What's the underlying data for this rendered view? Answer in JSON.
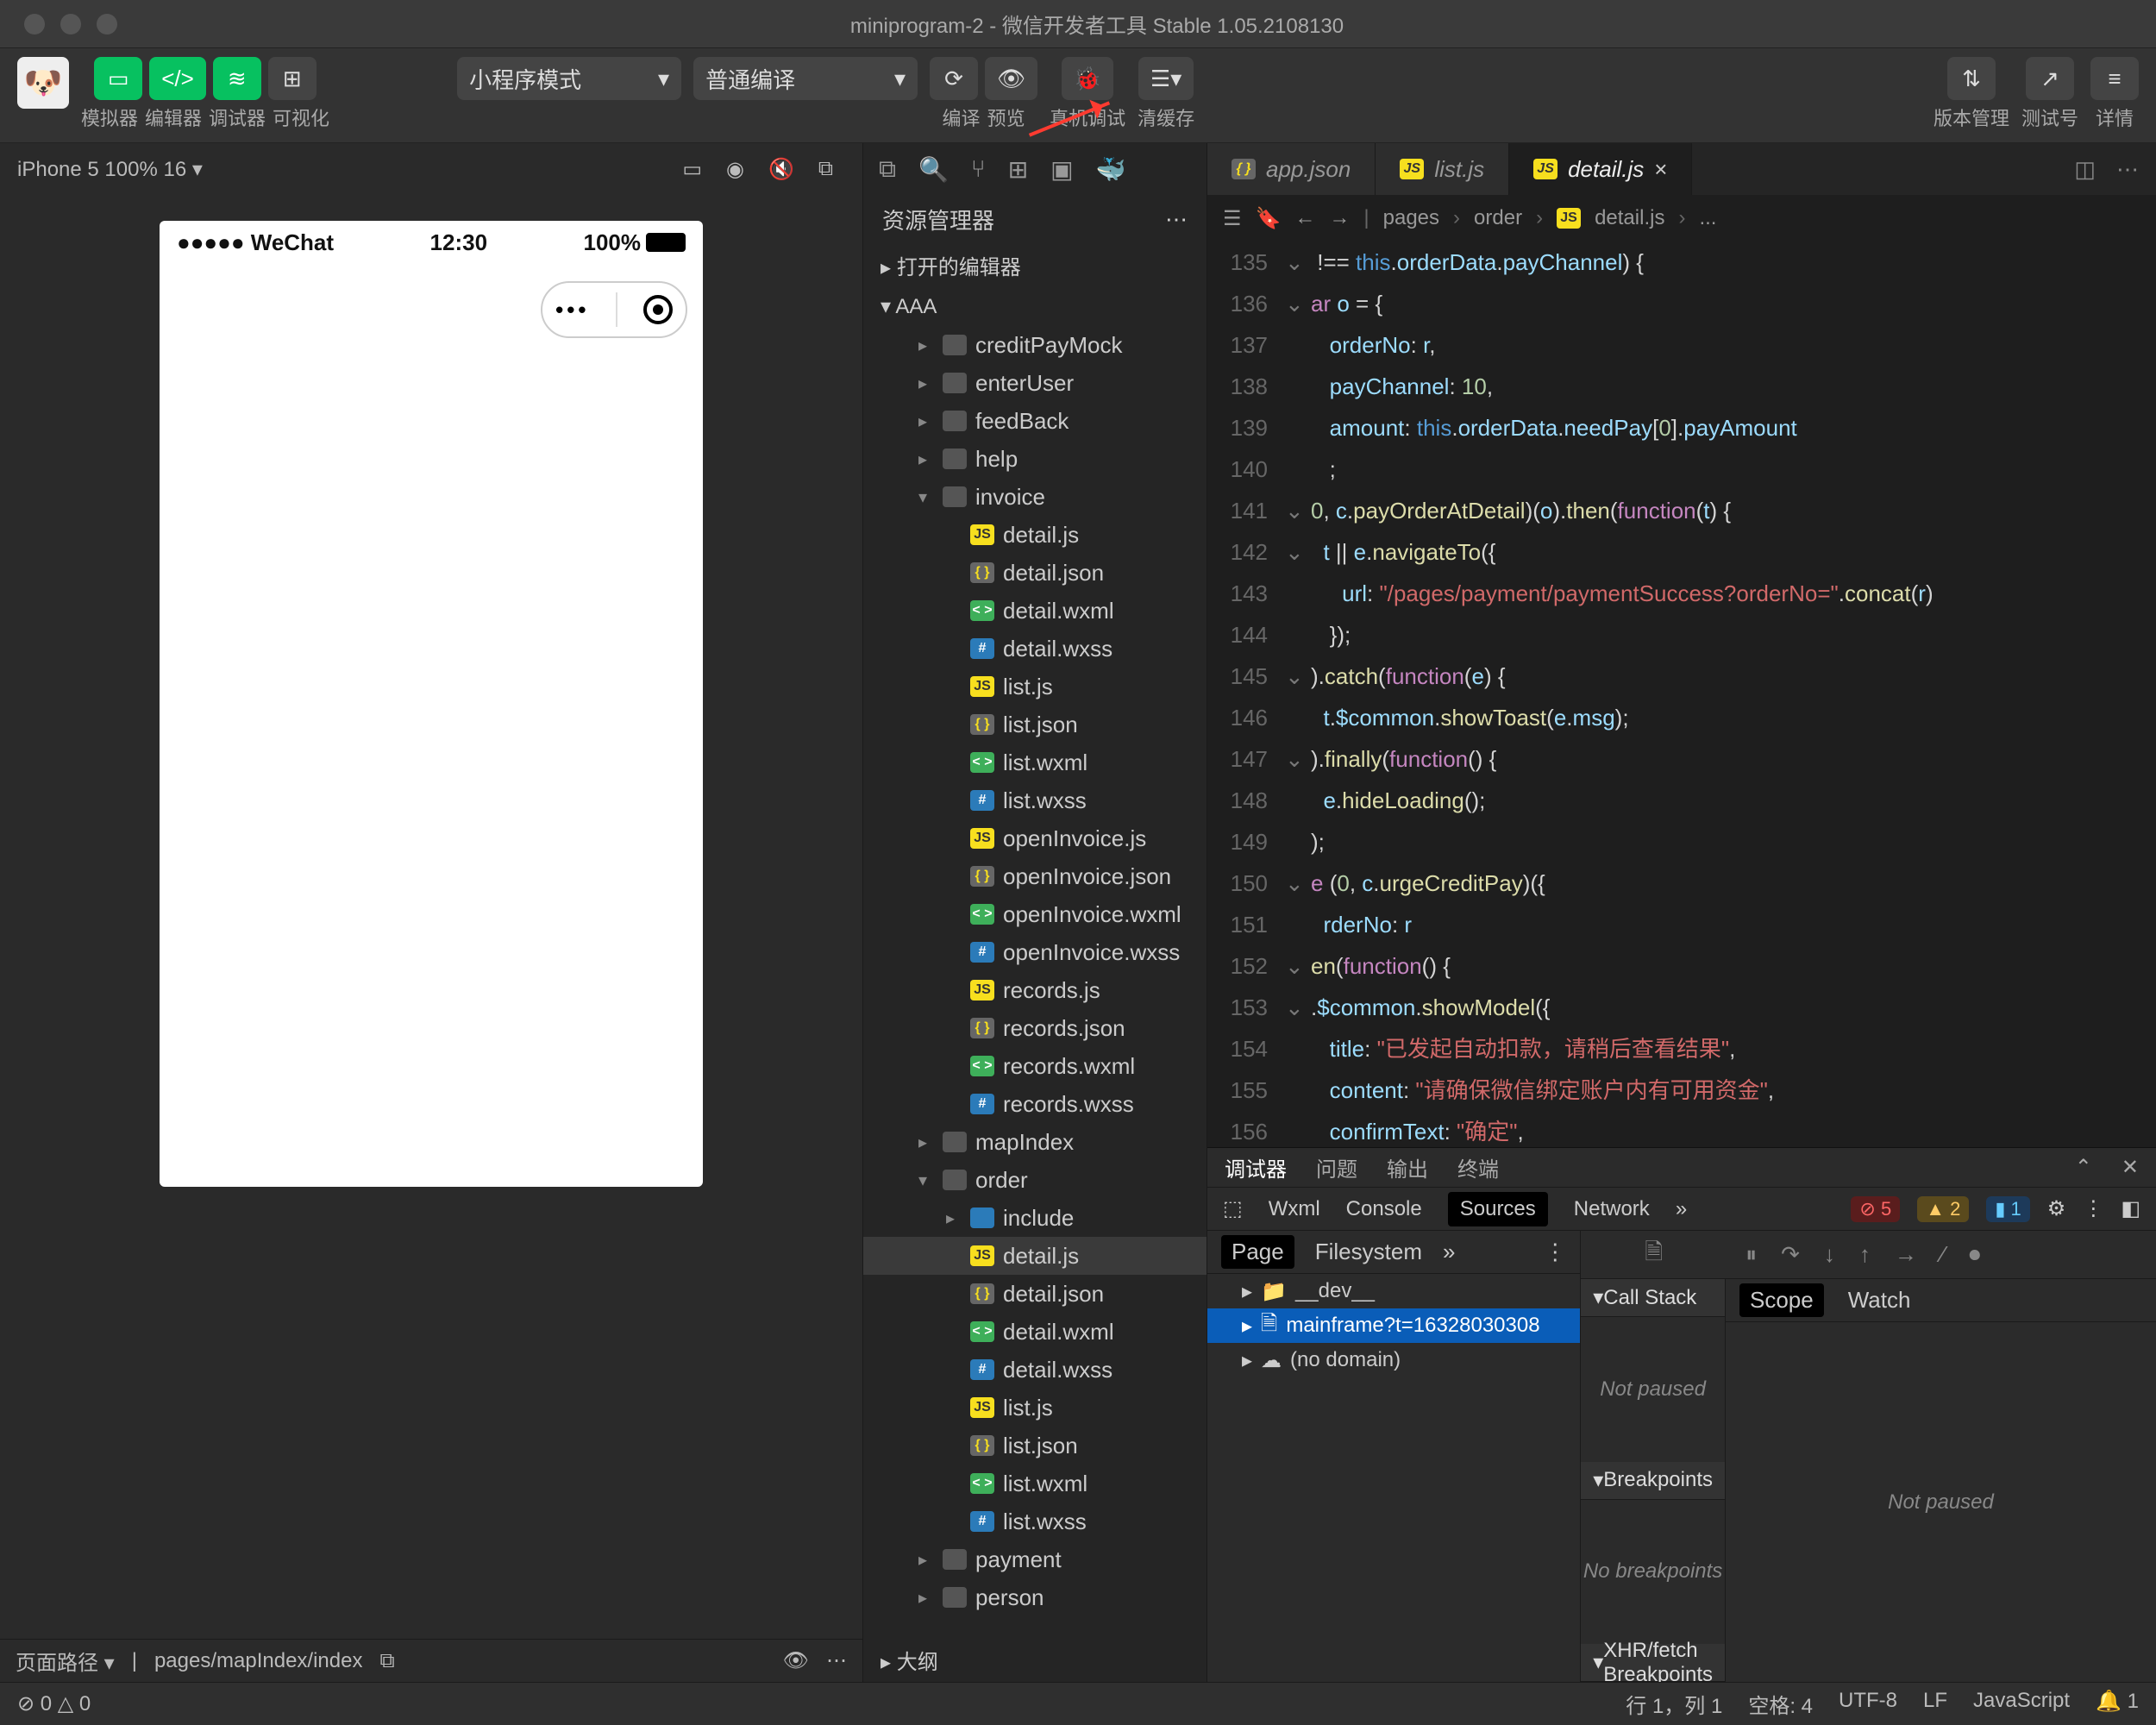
{
  "title": "miniprogram-2 - 微信开发者工具 Stable 1.05.2108130",
  "toolbar": {
    "tabs": [
      "模拟器",
      "编辑器",
      "调试器",
      "可视化"
    ],
    "mode": "小程序模式",
    "compile": "普通编译",
    "actions": [
      "编译",
      "预览",
      "真机调试",
      "清缓存"
    ],
    "right": [
      "版本管理",
      "测试号",
      "详情"
    ]
  },
  "sim": {
    "device": "iPhone 5 100% 16 ▾",
    "statusLeft": "●●●●● WeChat",
    "time": "12:30",
    "batt": "100%",
    "pathLabel": "页面路径 ▾",
    "path": "pages/mapIndex/index"
  },
  "explorer": {
    "header": "资源管理器",
    "openEditors": "打开的编辑器",
    "root": "AAA",
    "outline": "大纲",
    "tree": [
      {
        "t": "folder",
        "n": "creditPayMock",
        "d": 2
      },
      {
        "t": "folder",
        "n": "enterUser",
        "d": 2
      },
      {
        "t": "folder",
        "n": "feedBack",
        "d": 2
      },
      {
        "t": "folder",
        "n": "help",
        "d": 2
      },
      {
        "t": "folder",
        "n": "invoice",
        "d": 2,
        "open": true
      },
      {
        "t": "js",
        "n": "detail.js",
        "d": 3
      },
      {
        "t": "json",
        "n": "detail.json",
        "d": 3
      },
      {
        "t": "wxml",
        "n": "detail.wxml",
        "d": 3
      },
      {
        "t": "wxss",
        "n": "detail.wxss",
        "d": 3
      },
      {
        "t": "js",
        "n": "list.js",
        "d": 3
      },
      {
        "t": "json",
        "n": "list.json",
        "d": 3
      },
      {
        "t": "wxml",
        "n": "list.wxml",
        "d": 3
      },
      {
        "t": "wxss",
        "n": "list.wxss",
        "d": 3
      },
      {
        "t": "js",
        "n": "openInvoice.js",
        "d": 3
      },
      {
        "t": "json",
        "n": "openInvoice.json",
        "d": 3
      },
      {
        "t": "wxml",
        "n": "openInvoice.wxml",
        "d": 3
      },
      {
        "t": "wxss",
        "n": "openInvoice.wxss",
        "d": 3
      },
      {
        "t": "js",
        "n": "records.js",
        "d": 3
      },
      {
        "t": "json",
        "n": "records.json",
        "d": 3
      },
      {
        "t": "wxml",
        "n": "records.wxml",
        "d": 3
      },
      {
        "t": "wxss",
        "n": "records.wxss",
        "d": 3
      },
      {
        "t": "folder",
        "n": "mapIndex",
        "d": 2
      },
      {
        "t": "folder",
        "n": "order",
        "d": 2,
        "open": true
      },
      {
        "t": "folder",
        "n": "include",
        "d": 3,
        "blue": true
      },
      {
        "t": "js",
        "n": "detail.js",
        "d": 3,
        "sel": true
      },
      {
        "t": "json",
        "n": "detail.json",
        "d": 3
      },
      {
        "t": "wxml",
        "n": "detail.wxml",
        "d": 3
      },
      {
        "t": "wxss",
        "n": "detail.wxss",
        "d": 3
      },
      {
        "t": "js",
        "n": "list.js",
        "d": 3
      },
      {
        "t": "json",
        "n": "list.json",
        "d": 3
      },
      {
        "t": "wxml",
        "n": "list.wxml",
        "d": 3
      },
      {
        "t": "wxss",
        "n": "list.wxss",
        "d": 3
      },
      {
        "t": "folder",
        "n": "payment",
        "d": 2
      },
      {
        "t": "folder",
        "n": "person",
        "d": 2
      }
    ]
  },
  "tabs": [
    {
      "icon": "json",
      "label": "app.json"
    },
    {
      "icon": "js",
      "label": "list.js"
    },
    {
      "icon": "js",
      "label": "detail.js",
      "active": true,
      "close": true
    }
  ],
  "crumbs": [
    "pages",
    "order",
    "detail.js",
    "..."
  ],
  "code": [
    {
      "ln": 135,
      "f": 1,
      "h": "<span class='p'> !== </span><span class='o'>this</span><span class='p'>.</span><span class='v'>orderData</span><span class='p'>.</span><span class='v'>payChannel</span><span class='p'>) {</span>"
    },
    {
      "ln": 136,
      "f": 1,
      "h": "<span class='k'>ar</span><span class='p'> </span><span class='v'>o</span><span class='p'> = {</span>"
    },
    {
      "ln": 137,
      "h": "   <span class='v'>orderNo</span><span class='p'>: </span><span class='v'>r</span><span class='p'>,</span>"
    },
    {
      "ln": 138,
      "h": "   <span class='v'>payChannel</span><span class='p'>: </span><span class='n'>10</span><span class='p'>,</span>"
    },
    {
      "ln": 139,
      "h": "   <span class='v'>amount</span><span class='p'>: </span><span class='o'>this</span><span class='p'>.</span><span class='v'>orderData</span><span class='p'>.</span><span class='v'>needPay</span><span class='p'>[</span><span class='n'>0</span><span class='p'>].</span><span class='v'>payAmount</span>"
    },
    {
      "ln": 140,
      "h": "   <span class='p'>;</span>"
    },
    {
      "ln": 141,
      "f": 1,
      "h": "<span class='n'>0</span><span class='p'>, </span><span class='v'>c</span><span class='p'>.</span><span class='f'>payOrderAtDetail</span><span class='p'>)(</span><span class='v'>o</span><span class='p'>).</span><span class='f'>then</span><span class='p'>(</span><span class='k'>function</span><span class='p'>(</span><span class='v'>t</span><span class='p'>) {</span>"
    },
    {
      "ln": 142,
      "f": 1,
      "h": "  <span class='v'>t</span><span class='p'> || </span><span class='v'>e</span><span class='p'>.</span><span class='f'>navigateTo</span><span class='p'>({</span>"
    },
    {
      "ln": 143,
      "h": "     <span class='v'>url</span><span class='p'>: </span><span class='s2'>\"/pages/payment/paymentSuccess?orderNo=\"</span><span class='p'>.</span><span class='f'>concat</span><span class='p'>(</span><span class='v'>r</span><span class='p'>)</span>"
    },
    {
      "ln": 144,
      "h": "   <span class='p'>});</span>"
    },
    {
      "ln": 145,
      "f": 1,
      "h": "<span class='p'>).</span><span class='f'>catch</span><span class='p'>(</span><span class='k'>function</span><span class='p'>(</span><span class='v'>e</span><span class='p'>) {</span>"
    },
    {
      "ln": 146,
      "h": "  <span class='v'>t</span><span class='p'>.</span><span class='v'>$common</span><span class='p'>.</span><span class='f'>showToast</span><span class='p'>(</span><span class='v'>e</span><span class='p'>.</span><span class='v'>msg</span><span class='p'>);</span>"
    },
    {
      "ln": 147,
      "f": 1,
      "h": "<span class='p'>).</span><span class='f'>finally</span><span class='p'>(</span><span class='k'>function</span><span class='p'>() {</span>"
    },
    {
      "ln": 148,
      "h": "  <span class='v'>e</span><span class='p'>.</span><span class='f'>hideLoading</span><span class='p'>();</span>"
    },
    {
      "ln": 149,
      "h": "<span class='p'>);</span>"
    },
    {
      "ln": 150,
      "f": 1,
      "h": "<span class='k'>e</span><span class='p'> (</span><span class='n'>0</span><span class='p'>, </span><span class='v'>c</span><span class='p'>.</span><span class='f'>urgeCreditPay</span><span class='p'>)({</span>"
    },
    {
      "ln": 151,
      "h": "  <span class='v'>rderNo</span><span class='p'>: </span><span class='v'>r</span>"
    },
    {
      "ln": 152,
      "f": 1,
      "h": "<span class='f'>en</span><span class='p'>(</span><span class='k'>function</span><span class='p'>() {</span>"
    },
    {
      "ln": 153,
      "f": 1,
      "h": "<span class='p'>.</span><span class='v'>$common</span><span class='p'>.</span><span class='f'>showModel</span><span class='p'>({</span>"
    },
    {
      "ln": 154,
      "h": "   <span class='v'>title</span><span class='p'>: </span><span class='s2'>\"已发起自动扣款，请稍后查看结果\"</span><span class='p'>,</span>"
    },
    {
      "ln": 155,
      "h": "   <span class='v'>content</span><span class='p'>: </span><span class='s2'>\"请确保微信绑定账户内有可用资金\"</span><span class='p'>,</span>"
    },
    {
      "ln": 156,
      "h": "   <span class='v'>confirmText</span><span class='p'>: </span><span class='s2'>\"确定\"</span><span class='p'>,</span>"
    }
  ],
  "dev": {
    "topTabs": [
      "调试器",
      "问题",
      "输出",
      "终端"
    ],
    "tools": [
      "Wxml",
      "Console",
      "Sources",
      "Network"
    ],
    "err": "5",
    "warn": "2",
    "info": "1",
    "pageTabs": [
      "Page",
      "Filesystem"
    ],
    "srctree": [
      {
        "n": "__dev__",
        "ic": "fol"
      },
      {
        "n": "mainframe?t=16328030308",
        "sel": true,
        "ic": "file"
      },
      {
        "n": "(no domain)",
        "ic": "cloud"
      }
    ],
    "scopeTabs": [
      "Scope",
      "Watch"
    ],
    "notPaused": "Not paused",
    "callStack": "Call Stack",
    "breakpoints": "Breakpoints",
    "noBreak": "No breakpoints",
    "xhr": "XHR/fetch Breakpoints"
  },
  "status": {
    "errs": "⊘ 0 △ 0",
    "line": "行 1，列 1",
    "spaces": "空格: 4",
    "enc": "UTF-8",
    "eol": "LF",
    "lang": "JavaScript",
    "bell": "1"
  }
}
